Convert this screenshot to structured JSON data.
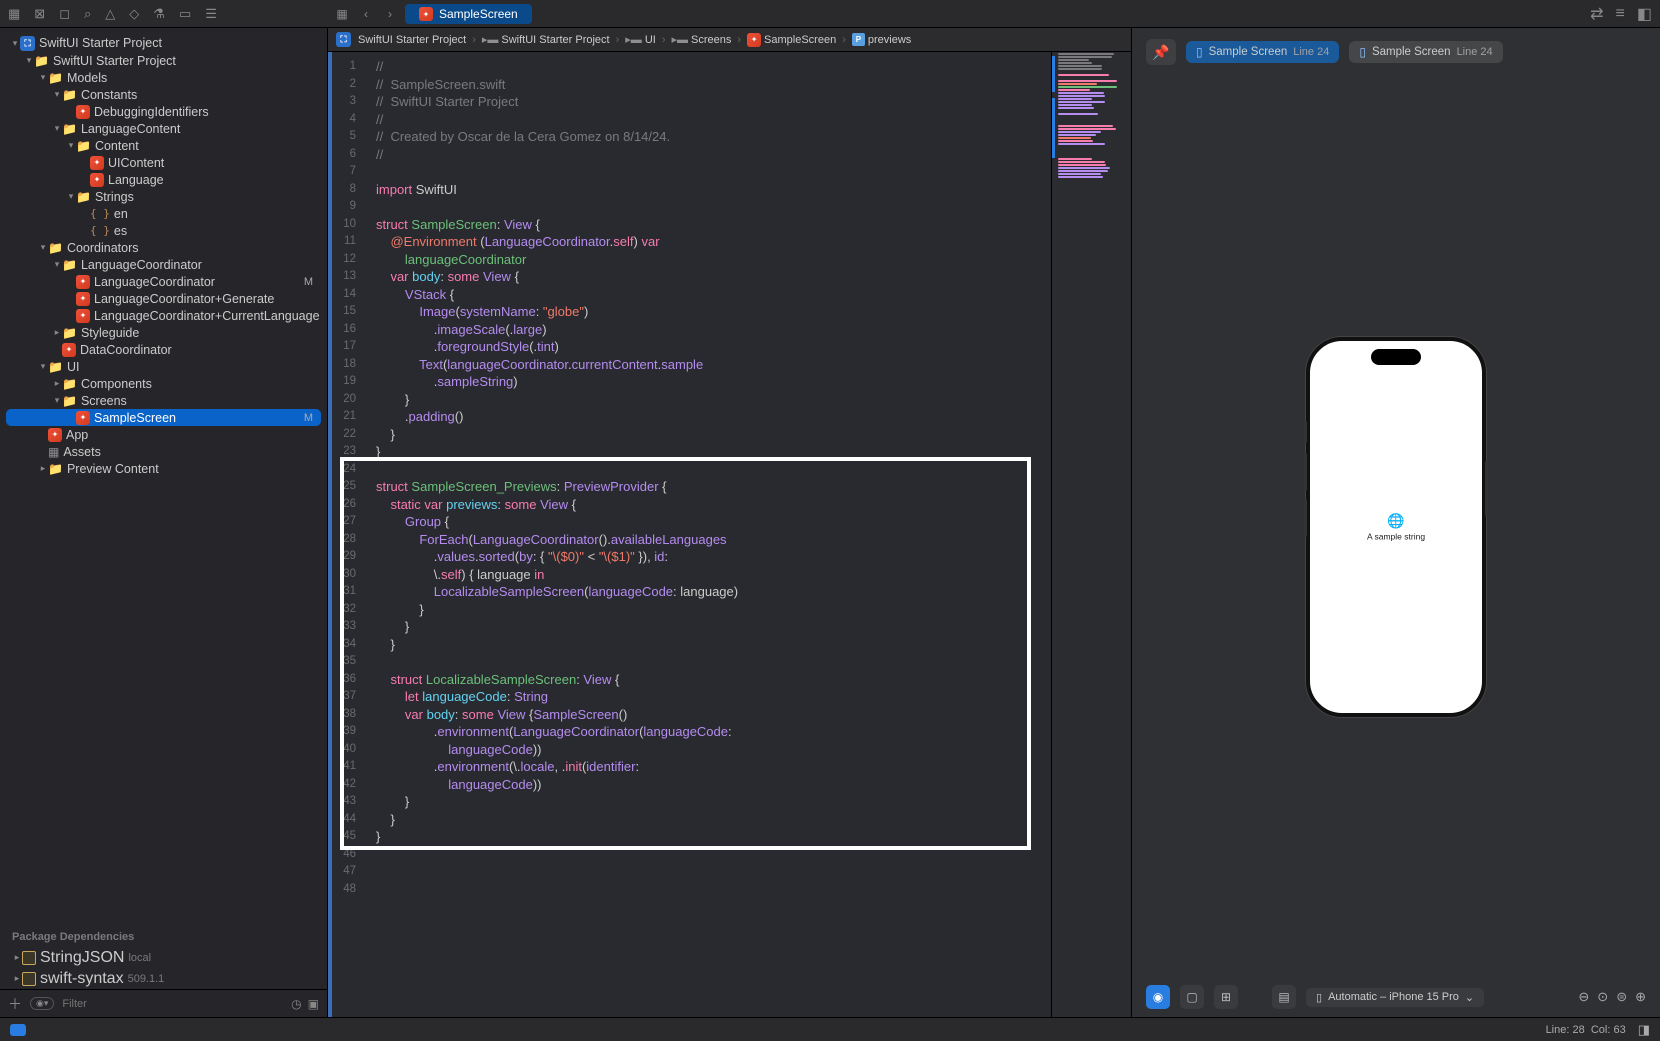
{
  "toolbar_icons": [
    "folder",
    "x-square",
    "bookmark",
    "search",
    "warning",
    "tag",
    "flask",
    "rectangle",
    "doc"
  ],
  "nav_icons": [
    "grid",
    "back",
    "forward"
  ],
  "active_tab": "SampleScreen",
  "right_icons": [
    "refresh",
    "list",
    "sidebar-right"
  ],
  "breadcrumbs": [
    {
      "icon": "proj",
      "label": "SwiftUI Starter Project"
    },
    {
      "icon": "folder",
      "label": "SwiftUI Starter Project"
    },
    {
      "icon": "folder",
      "label": "UI"
    },
    {
      "icon": "folder",
      "label": "Screens"
    },
    {
      "icon": "swift",
      "label": "SampleScreen"
    },
    {
      "icon": "prop",
      "label": "previews"
    }
  ],
  "sidebar": {
    "tree": [
      {
        "d": 0,
        "chev": "v",
        "icon": "proj",
        "label": "SwiftUI Starter Project"
      },
      {
        "d": 1,
        "chev": "v",
        "icon": "folder",
        "label": "SwiftUI Starter Project"
      },
      {
        "d": 2,
        "chev": "v",
        "icon": "folder",
        "label": "Models"
      },
      {
        "d": 3,
        "chev": "v",
        "icon": "folder",
        "label": "Constants"
      },
      {
        "d": 4,
        "chev": "",
        "icon": "swift",
        "label": "DebuggingIdentifiers"
      },
      {
        "d": 3,
        "chev": "v",
        "icon": "folder",
        "label": "LanguageContent"
      },
      {
        "d": 4,
        "chev": "v",
        "icon": "folder",
        "label": "Content"
      },
      {
        "d": 5,
        "chev": "",
        "icon": "swift",
        "label": "UIContent"
      },
      {
        "d": 5,
        "chev": "",
        "icon": "swift",
        "label": "Language"
      },
      {
        "d": 4,
        "chev": "v",
        "icon": "folder",
        "label": "Strings"
      },
      {
        "d": 5,
        "chev": "",
        "icon": "brace",
        "label": "en"
      },
      {
        "d": 5,
        "chev": "",
        "icon": "brace",
        "label": "es"
      },
      {
        "d": 2,
        "chev": "v",
        "icon": "folder",
        "label": "Coordinators"
      },
      {
        "d": 3,
        "chev": "v",
        "icon": "folder",
        "label": "LanguageCoordinator"
      },
      {
        "d": 4,
        "chev": "",
        "icon": "swift",
        "label": "LanguageCoordinator",
        "badge": "M"
      },
      {
        "d": 4,
        "chev": "",
        "icon": "swift",
        "label": "LanguageCoordinator+Generate"
      },
      {
        "d": 4,
        "chev": "",
        "icon": "swift",
        "label": "LanguageCoordinator+CurrentLanguage"
      },
      {
        "d": 3,
        "chev": ">",
        "icon": "folder",
        "label": "Styleguide"
      },
      {
        "d": 3,
        "chev": "",
        "icon": "swift",
        "label": "DataCoordinator"
      },
      {
        "d": 2,
        "chev": "v",
        "icon": "folder",
        "label": "UI"
      },
      {
        "d": 3,
        "chev": ">",
        "icon": "folder",
        "label": "Components"
      },
      {
        "d": 3,
        "chev": "v",
        "icon": "folder",
        "label": "Screens"
      },
      {
        "d": 4,
        "chev": "",
        "icon": "swift",
        "label": "SampleScreen",
        "badge": "M",
        "sel": true
      },
      {
        "d": 2,
        "chev": "",
        "icon": "swift",
        "label": "App"
      },
      {
        "d": 2,
        "chev": "",
        "icon": "assets",
        "label": "Assets"
      },
      {
        "d": 2,
        "chev": ">",
        "icon": "folder",
        "label": "Preview Content"
      }
    ],
    "pkg_header": "Package Dependencies",
    "packages": [
      {
        "label": "StringJSON",
        "tag": "local"
      },
      {
        "label": "swift-syntax",
        "tag": "509.1.1"
      }
    ],
    "filter_placeholder": "Filter"
  },
  "code": [
    {
      "n": 1,
      "t": [
        [
          "cmt",
          "//"
        ]
      ]
    },
    {
      "n": 2,
      "t": [
        [
          "cmt",
          "//  SampleScreen.swift"
        ]
      ]
    },
    {
      "n": 3,
      "t": [
        [
          "cmt",
          "//  SwiftUI Starter Project"
        ]
      ]
    },
    {
      "n": 4,
      "t": [
        [
          "cmt",
          "//"
        ]
      ]
    },
    {
      "n": 5,
      "t": [
        [
          "cmt",
          "//  Created by Oscar de la Cera Gomez on 8/14/24."
        ]
      ]
    },
    {
      "n": 6,
      "t": [
        [
          "cmt",
          "//"
        ]
      ]
    },
    {
      "n": 7,
      "t": [
        [
          "",
          ""
        ]
      ]
    },
    {
      "n": 8,
      "t": [
        [
          "kw",
          "import"
        ],
        [
          "",
          " SwiftUI"
        ]
      ]
    },
    {
      "n": 9,
      "t": [
        [
          "",
          ""
        ]
      ]
    },
    {
      "n": 10,
      "t": [
        [
          "kw",
          "struct"
        ],
        [
          "",
          " "
        ],
        [
          "id",
          "SampleScreen"
        ],
        [
          "",
          ": "
        ],
        [
          "type2",
          "View"
        ],
        [
          "",
          " {"
        ]
      ]
    },
    {
      "n": 11,
      "t": [
        [
          "",
          "    "
        ],
        [
          "attr",
          "@Environment"
        ],
        [
          "",
          " ("
        ],
        [
          "type2",
          "LanguageCoordinator"
        ],
        [
          "",
          "."
        ],
        [
          "kw",
          "self"
        ],
        [
          "",
          ") "
        ],
        [
          "kw",
          "var"
        ]
      ]
    },
    {
      "n": 12,
      "t": [
        [
          "",
          "        "
        ],
        [
          "id",
          "languageCoordinator"
        ]
      ]
    },
    {
      "n": 13,
      "t": [
        [
          "",
          "    "
        ],
        [
          "kw",
          "var"
        ],
        [
          "",
          " "
        ],
        [
          "type",
          "body"
        ],
        [
          "",
          ": "
        ],
        [
          "kw",
          "some"
        ],
        [
          "",
          " "
        ],
        [
          "type2",
          "View"
        ],
        [
          "",
          " {"
        ]
      ]
    },
    {
      "n": 14,
      "t": [
        [
          "",
          "        "
        ],
        [
          "type2",
          "VStack"
        ],
        [
          "",
          " {"
        ]
      ]
    },
    {
      "n": 15,
      "t": [
        [
          "",
          "            "
        ],
        [
          "type2",
          "Image"
        ],
        [
          "",
          "("
        ],
        [
          "fn",
          "systemName"
        ],
        [
          "",
          ": "
        ],
        [
          "str",
          "\"globe\""
        ],
        [
          "",
          ")"
        ]
      ]
    },
    {
      "n": 16,
      "t": [
        [
          "",
          "                ."
        ],
        [
          "fn",
          "imageScale"
        ],
        [
          "",
          "(."
        ],
        [
          "type2",
          "large"
        ],
        [
          "",
          ")"
        ]
      ]
    },
    {
      "n": 17,
      "t": [
        [
          "",
          "                ."
        ],
        [
          "fn",
          "foregroundStyle"
        ],
        [
          "",
          "(."
        ],
        [
          "type2",
          "tint"
        ],
        [
          "",
          ")"
        ]
      ]
    },
    {
      "n": 18,
      "t": [
        [
          "",
          "            "
        ],
        [
          "type2",
          "Text"
        ],
        [
          "",
          "("
        ],
        [
          "type2",
          "languageCoordinator"
        ],
        [
          "",
          "."
        ],
        [
          "type2",
          "currentContent"
        ],
        [
          "",
          "."
        ],
        [
          "type2",
          "sample"
        ]
      ]
    },
    {
      "n": 19,
      "t": [
        [
          "",
          "                ."
        ],
        [
          "fn",
          "sampleString"
        ],
        [
          "",
          ")"
        ]
      ]
    },
    {
      "n": 20,
      "t": [
        [
          "",
          "        }"
        ],
        [
          "",
          "\n"
        ]
      ],
      "raw": "        }"
    },
    {
      "n": 21,
      "t": [
        [
          "",
          "        ."
        ],
        [
          "fn",
          "padding"
        ],
        [
          "",
          "()"
        ]
      ]
    },
    {
      "n": 22,
      "t": [
        [
          "",
          "    }"
        ]
      ],
      "raw": "    }"
    },
    {
      "n": 23,
      "t": [
        [
          "",
          "}"
        ]
      ],
      "raw": "}"
    },
    {
      "n": 24,
      "t": [
        [
          "",
          ""
        ]
      ]
    },
    {
      "n": 25,
      "t": [
        [
          "kw",
          "struct"
        ],
        [
          "",
          " "
        ],
        [
          "id",
          "SampleScreen_Previews"
        ],
        [
          "",
          ": "
        ],
        [
          "type2",
          "PreviewProvider"
        ],
        [
          "",
          " {"
        ]
      ]
    },
    {
      "n": 26,
      "t": [
        [
          "",
          "    "
        ],
        [
          "kw",
          "static"
        ],
        [
          "",
          " "
        ],
        [
          "kw",
          "var"
        ],
        [
          "",
          " "
        ],
        [
          "type",
          "previews"
        ],
        [
          "",
          ": "
        ],
        [
          "kw",
          "some"
        ],
        [
          "",
          " "
        ],
        [
          "type2",
          "View"
        ],
        [
          "",
          " {"
        ]
      ]
    },
    {
      "n": 27,
      "t": [
        [
          "",
          "        "
        ],
        [
          "type2",
          "Group"
        ],
        [
          "",
          " {"
        ]
      ]
    },
    {
      "n": 28,
      "t": [
        [
          "",
          "            "
        ],
        [
          "type2",
          "ForEach"
        ],
        [
          "",
          "("
        ],
        [
          "type2",
          "LanguageCoordinator"
        ],
        [
          "",
          "()."
        ],
        [
          "type2",
          "availableLanguages"
        ]
      ]
    },
    {
      "n": 29,
      "t": [
        [
          "",
          "                ."
        ],
        [
          "fn",
          "values"
        ],
        [
          "",
          "."
        ],
        [
          "fn",
          "sorted"
        ],
        [
          "",
          "("
        ],
        [
          "fn",
          "by"
        ],
        [
          "",
          ": { "
        ],
        [
          "str",
          "\"\\($0)\""
        ],
        [
          "",
          " < "
        ],
        [
          "str",
          "\"\\($1)\""
        ],
        [
          "",
          " }), "
        ],
        [
          "fn",
          "id"
        ],
        [
          "",
          ":"
        ]
      ]
    },
    {
      "n": 30,
      "t": [
        [
          "",
          "                \\."
        ],
        [
          "kw",
          "self"
        ],
        [
          "",
          ") { language "
        ],
        [
          "kw",
          "in"
        ]
      ]
    },
    {
      "n": 31,
      "t": [
        [
          "",
          "                "
        ],
        [
          "type2",
          "LocalizableSampleScreen"
        ],
        [
          "",
          "("
        ],
        [
          "fn",
          "languageCode"
        ],
        [
          "",
          ": language)"
        ]
      ]
    },
    {
      "n": 32,
      "t": [
        [
          "",
          "            }"
        ]
      ],
      "raw": "            }"
    },
    {
      "n": 33,
      "t": [
        [
          "",
          "        }"
        ]
      ],
      "raw": "        }"
    },
    {
      "n": 34,
      "t": [
        [
          "",
          "    }"
        ]
      ],
      "raw": "    }"
    },
    {
      "n": 35,
      "t": [
        [
          "",
          ""
        ]
      ]
    },
    {
      "n": 36,
      "t": [
        [
          "",
          "    "
        ],
        [
          "kw",
          "struct"
        ],
        [
          "",
          " "
        ],
        [
          "id",
          "LocalizableSampleScreen"
        ],
        [
          "",
          ": "
        ],
        [
          "type2",
          "View"
        ],
        [
          "",
          " {"
        ]
      ]
    },
    {
      "n": 37,
      "t": [
        [
          "",
          "        "
        ],
        [
          "kw",
          "let"
        ],
        [
          "",
          " "
        ],
        [
          "type",
          "languageCode"
        ],
        [
          "",
          ": "
        ],
        [
          "type2",
          "String"
        ]
      ]
    },
    {
      "n": 38,
      "t": [
        [
          "",
          "        "
        ],
        [
          "kw",
          "var"
        ],
        [
          "",
          " "
        ],
        [
          "type",
          "body"
        ],
        [
          "",
          ": "
        ],
        [
          "kw",
          "some"
        ],
        [
          "",
          " "
        ],
        [
          "type2",
          "View"
        ],
        [
          "",
          " {"
        ],
        [
          "type2",
          "SampleScreen"
        ],
        [
          "",
          "()"
        ]
      ]
    },
    {
      "n": 39,
      "t": [
        [
          "",
          "                ."
        ],
        [
          "fn",
          "environment"
        ],
        [
          "",
          "("
        ],
        [
          "type2",
          "LanguageCoordinator"
        ],
        [
          "",
          "("
        ],
        [
          "fn",
          "languageCode"
        ],
        [
          "",
          ":"
        ]
      ]
    },
    {
      "n": 40,
      "t": [
        [
          "",
          "                    "
        ],
        [
          "type2",
          "languageCode"
        ],
        [
          "",
          "))"
        ]
      ]
    },
    {
      "n": 41,
      "t": [
        [
          "",
          "                ."
        ],
        [
          "fn",
          "environment"
        ],
        [
          "",
          "(\\."
        ],
        [
          "type2",
          "locale"
        ],
        [
          "",
          ", ."
        ],
        [
          "kw",
          "init"
        ],
        [
          "",
          "("
        ],
        [
          "fn",
          "identifier"
        ],
        [
          "",
          ":"
        ]
      ]
    },
    {
      "n": 42,
      "t": [
        [
          "",
          "                    "
        ],
        [
          "type2",
          "languageCode"
        ],
        [
          "",
          "))"
        ]
      ]
    },
    {
      "n": 43,
      "t": [
        [
          "",
          "        }"
        ]
      ],
      "raw": "        }"
    },
    {
      "n": 44,
      "t": [
        [
          "",
          "    }"
        ]
      ],
      "raw": "    }"
    },
    {
      "n": 45,
      "t": [
        [
          "",
          "}"
        ]
      ],
      "raw": "}"
    },
    {
      "n": 46,
      "t": [
        [
          "",
          ""
        ]
      ]
    },
    {
      "n": 47,
      "t": [
        [
          "",
          ""
        ]
      ]
    },
    {
      "n": 48,
      "t": [
        [
          "",
          ""
        ]
      ]
    }
  ],
  "highlight_box": {
    "top_line": 24,
    "height_lines": 22
  },
  "preview": {
    "chips": [
      {
        "label": "Sample Screen",
        "line": "Line 24",
        "active": true
      },
      {
        "label": "Sample Screen",
        "line": "Line 24",
        "active": false
      }
    ],
    "phone_text": "A sample string",
    "device_selector": "Automatic – iPhone 15 Pro"
  },
  "status": {
    "line": "Line: 28",
    "col": "Col: 63"
  }
}
